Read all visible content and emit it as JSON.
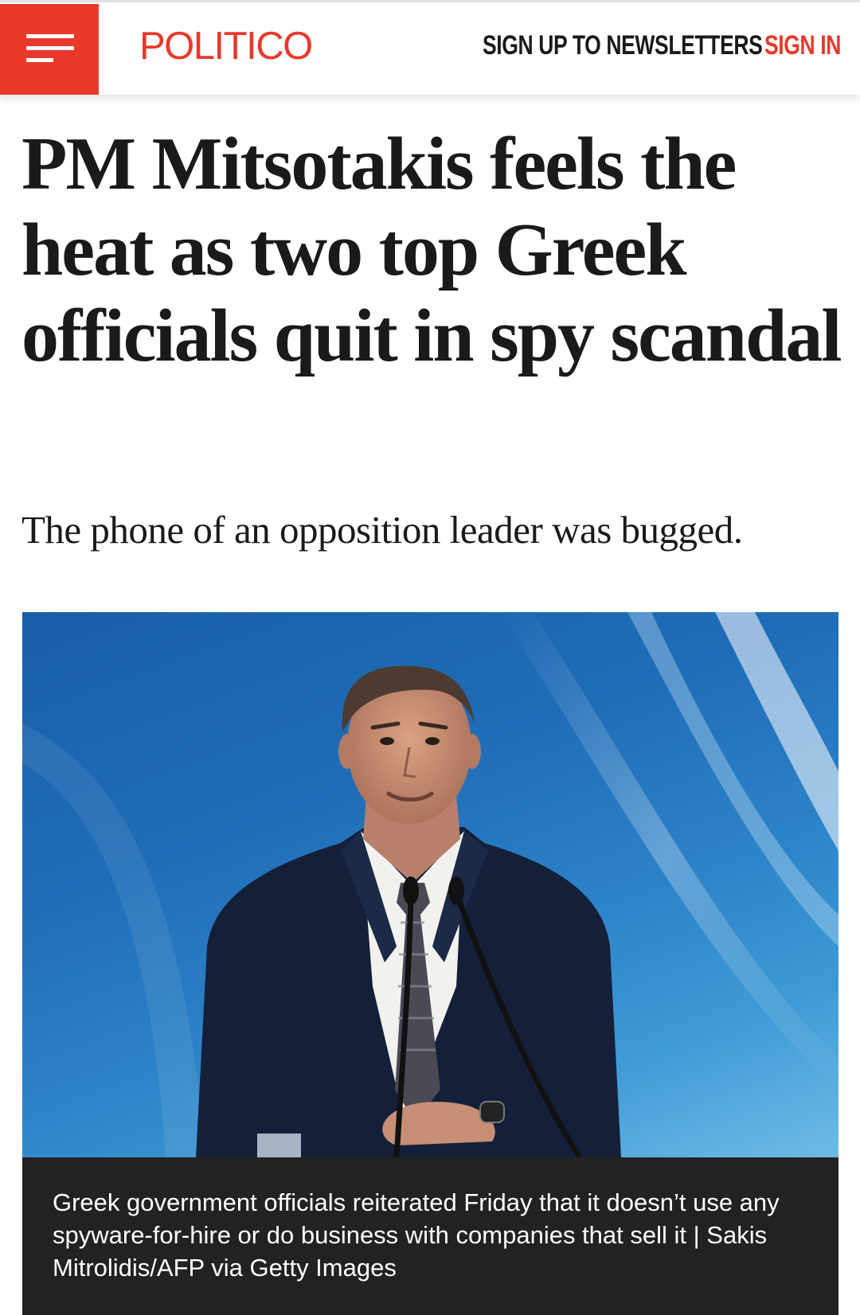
{
  "header": {
    "logo": "POLITICO",
    "newsletters_label": "SIGN UP TO NEWSLETTERS",
    "signin_label": "SIGN IN",
    "accent_color": "#e8392b"
  },
  "article": {
    "headline": "PM Mitsotakis feels the heat as two top Greek officials quit in spy scandal",
    "dek": "The phone of an opposition leader was bugged.",
    "image_caption": "Greek government officials reiterated Friday that it doesn’t use any spyware-for-hire or do business with companies that sell it | Sakis Mitrolidis/AFP via Getty Images"
  },
  "icons": {
    "menu": "hamburger-menu-icon"
  }
}
